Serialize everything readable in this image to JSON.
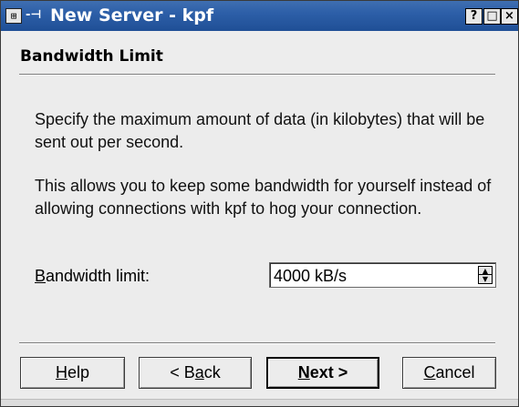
{
  "window": {
    "title": "New Server - kpf",
    "system_icon": "window-menu-icon",
    "sticky_icon": "sticky-icon",
    "buttons": {
      "help": "?",
      "maximize": "□",
      "close": "×"
    }
  },
  "page": {
    "title": "Bandwidth Limit",
    "description": "Specify the maximum amount of data (in kilobytes) that will be sent out per second.",
    "note": "This allows you to keep some bandwidth for yourself instead of allowing connections with kpf to hog your connection.",
    "bandwidth_label_accel": "B",
    "bandwidth_label_rest": "andwidth limit:",
    "bandwidth_value": "4000 kB/s"
  },
  "footer": {
    "help_accel": "H",
    "help_rest": "elp",
    "back_pre": "< B",
    "back_accel": "a",
    "back_rest": "ck",
    "next_accel": "N",
    "next_rest": "ext >",
    "cancel_accel": "C",
    "cancel_rest": "ancel"
  }
}
